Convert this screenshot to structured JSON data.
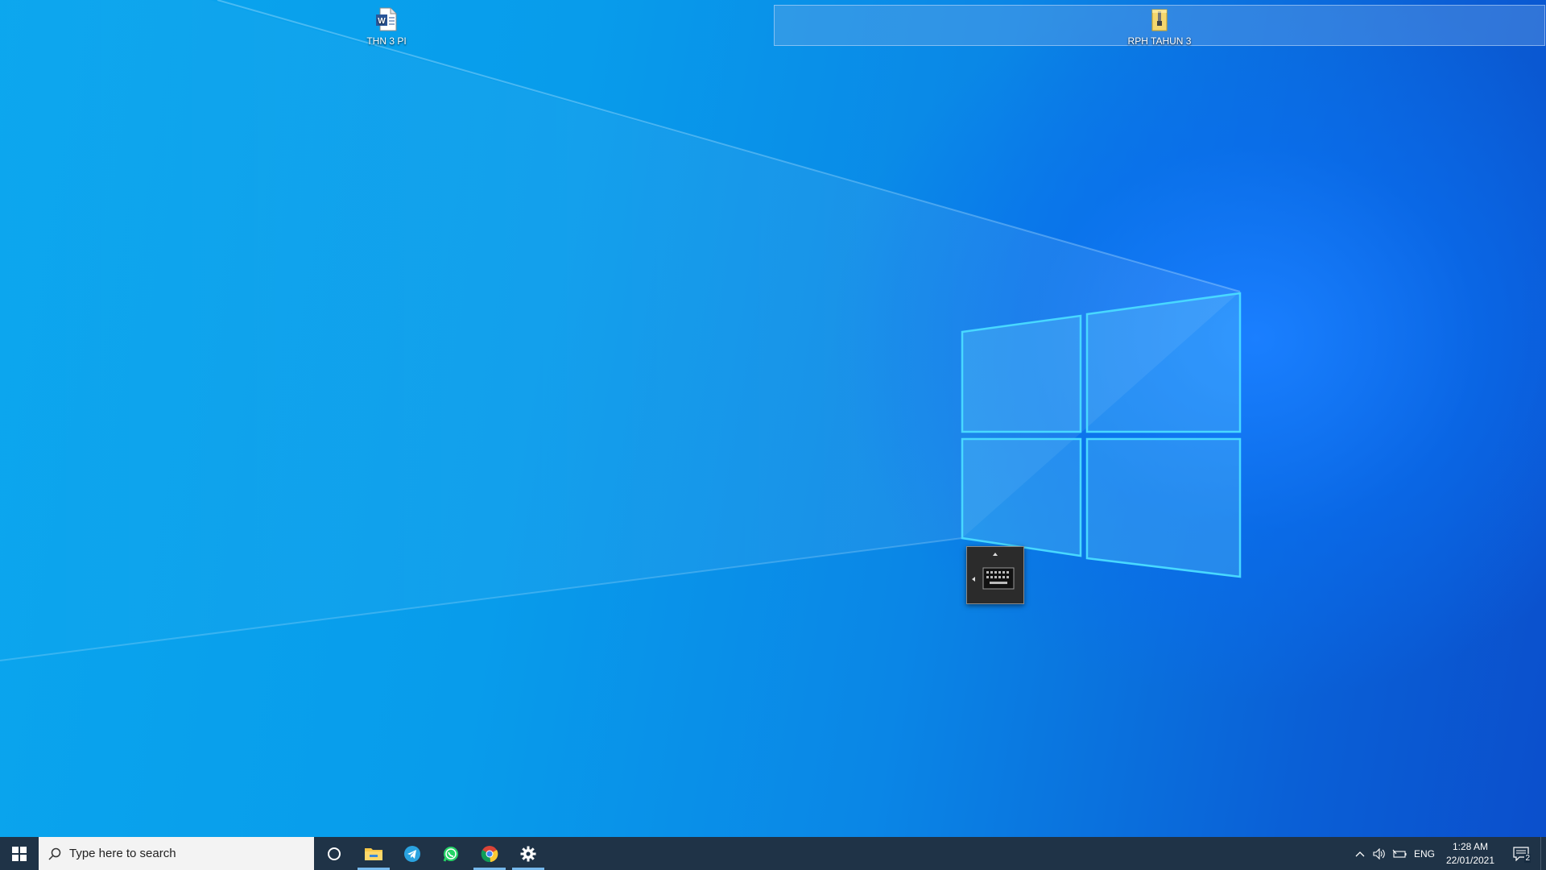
{
  "desktop": {
    "icons": [
      {
        "label": "THN 3 PI",
        "icon": "word-document-icon"
      },
      {
        "label": "RPH TAHUN 3",
        "icon": "zip-folder-icon"
      }
    ]
  },
  "taskbar": {
    "start_icon": "windows-start-icon",
    "search": {
      "placeholder": "Type here to search",
      "icon": "search-icon"
    },
    "pinned_apps": [
      {
        "name": "Cortana",
        "icon": "cortana-circle-icon",
        "active": false
      },
      {
        "name": "File Explorer",
        "icon": "file-explorer-icon",
        "active": true
      },
      {
        "name": "Telegram",
        "icon": "telegram-icon",
        "active": false
      },
      {
        "name": "WhatsApp",
        "icon": "whatsapp-icon",
        "active": false
      },
      {
        "name": "Google Chrome",
        "icon": "chrome-icon",
        "active": true
      },
      {
        "name": "Settings",
        "icon": "gear-icon",
        "active": true
      }
    ],
    "tray": {
      "chevron_icon": "chevron-up-icon",
      "volume_icon": "volume-icon",
      "battery_icon": "battery-icon",
      "language": "ENG",
      "time": "1:28 AM",
      "date": "22/01/2021",
      "notifications_count": "2"
    }
  },
  "colors": {
    "taskbar_bg": "#162b40",
    "active_indicator": "#76b9ed"
  }
}
